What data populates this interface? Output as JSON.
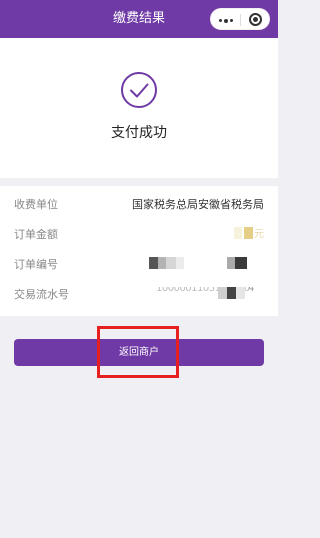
{
  "navbar": {
    "title": "缴费结果",
    "bg_color": "#6f3aa5"
  },
  "result": {
    "status_text": "支付成功",
    "icon": "check-circle-icon"
  },
  "details": {
    "payee_label": "收费单位",
    "payee_value": "国家税务总局安徽省税务局",
    "amount_label": "订单金额",
    "amount_suffix": "元",
    "order_no_label": "订单编号",
    "serial_no_label": "交易流水号",
    "serial_no_partial": "1000001105105070",
    "serial_no_tail": "4"
  },
  "actions": {
    "return_label": "返回商户"
  },
  "annotation": {
    "color": "#e5201f"
  }
}
